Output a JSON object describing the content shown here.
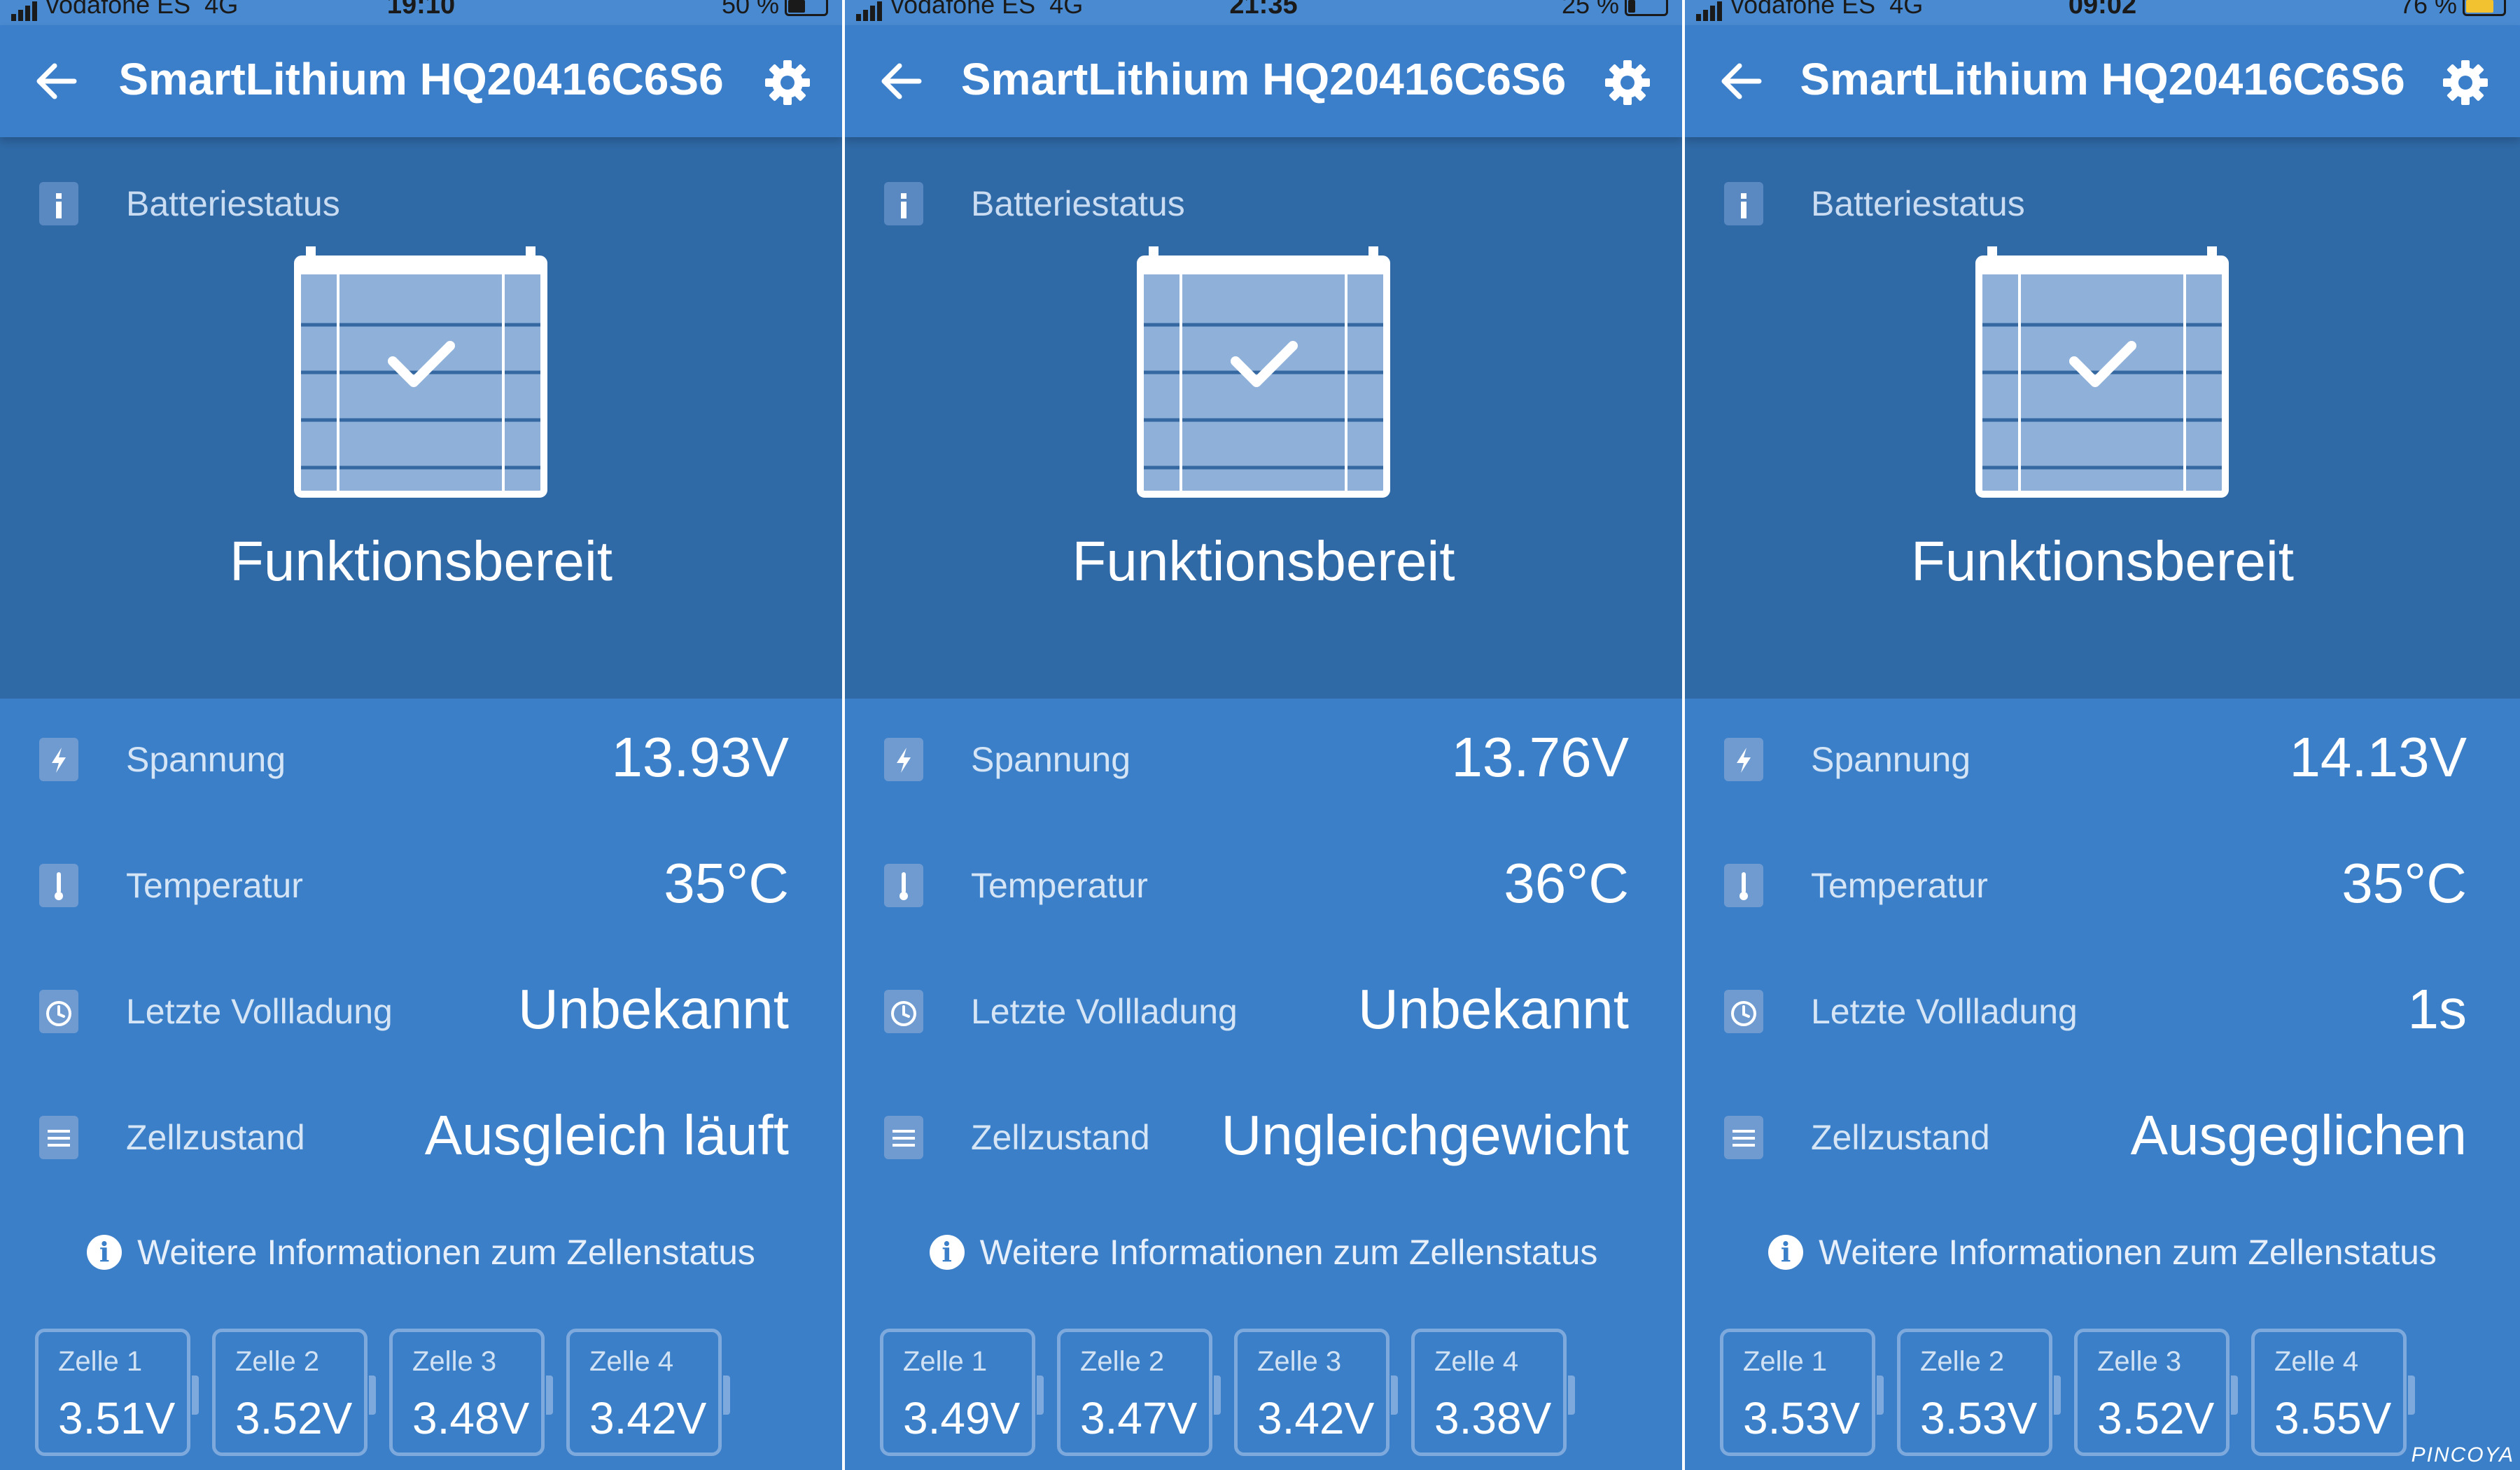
{
  "title": "SmartLithium HQ20416C6S6",
  "section_label": "Batteriestatus",
  "battery_state": "Funktionsbereit",
  "labels": {
    "voltage": "Spannung",
    "temperature": "Temperatur",
    "last_full_charge": "Letzte Vollladung",
    "cell_state": "Zellzustand"
  },
  "info_link": "Weitere Informationen zum Zellenstatus",
  "icons": {
    "back": "arrow-left-icon",
    "settings": "gear-icon",
    "info_box": "info-square-icon",
    "battery": "battery-ok-icon",
    "voltage": "lightning-icon",
    "temperature": "thermometer-icon",
    "last_full_charge": "clock-icon",
    "cell_state": "lines-icon",
    "info": "info-circle-icon"
  },
  "colors": {
    "app_bar": "#3b7fca",
    "status_section": "#2f69a6",
    "panel": "#3a7fc8",
    "cell_border": "#7ea9dc"
  },
  "screens": [
    {
      "status": {
        "carrier": "vodafone ES",
        "network": "4G",
        "time": "19:10",
        "battery_pct": "50 %",
        "battery_level": 0.5
      },
      "voltage": "13.93V",
      "temperature": "35°C",
      "last_full_charge": "Unbekannt",
      "cell_state": "Ausgleich läuft",
      "cells": [
        {
          "name": "Zelle 1",
          "voltage": "3.51V"
        },
        {
          "name": "Zelle 2",
          "voltage": "3.52V"
        },
        {
          "name": "Zelle 3",
          "voltage": "3.48V"
        },
        {
          "name": "Zelle 4",
          "voltage": "3.42V"
        }
      ]
    },
    {
      "status": {
        "carrier": "vodafone ES",
        "network": "4G",
        "time": "21:35",
        "battery_pct": "25 %",
        "battery_level": 0.25
      },
      "voltage": "13.76V",
      "temperature": "36°C",
      "last_full_charge": "Unbekannt",
      "cell_state": "Ungleichgewicht",
      "cells": [
        {
          "name": "Zelle 1",
          "voltage": "3.49V"
        },
        {
          "name": "Zelle 2",
          "voltage": "3.47V"
        },
        {
          "name": "Zelle 3",
          "voltage": "3.42V"
        },
        {
          "name": "Zelle 4",
          "voltage": "3.38V"
        }
      ]
    },
    {
      "status": {
        "carrier": "vodafone ES",
        "network": "4G",
        "time": "09:02",
        "battery_pct": "76 %",
        "battery_level": 0.76
      },
      "voltage": "14.13V",
      "temperature": "35°C",
      "last_full_charge": "1s",
      "cell_state": "Ausgeglichen",
      "cells": [
        {
          "name": "Zelle 1",
          "voltage": "3.53V"
        },
        {
          "name": "Zelle 2",
          "voltage": "3.53V"
        },
        {
          "name": "Zelle 3",
          "voltage": "3.52V"
        },
        {
          "name": "Zelle 4",
          "voltage": "3.55V"
        }
      ]
    }
  ],
  "watermark": "PINCOYA"
}
